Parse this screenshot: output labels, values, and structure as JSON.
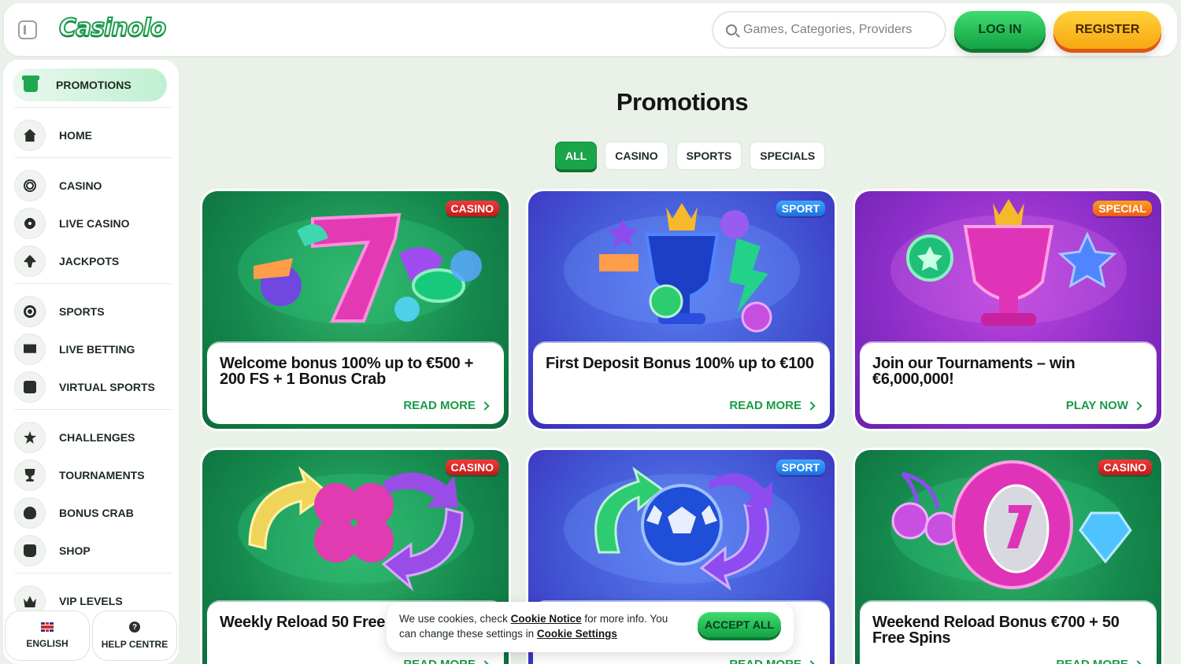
{
  "header": {
    "logo_text": "Casinolo",
    "search_placeholder": "Games, Categories, Providers",
    "login_label": "LOG IN",
    "register_label": "REGISTER"
  },
  "sidebar": {
    "promotions_label": "PROMOTIONS",
    "items": [
      {
        "label": "HOME",
        "icon": "home-icon"
      },
      {
        "label": "CASINO",
        "icon": "casino-chip-icon"
      },
      {
        "label": "LIVE CASINO",
        "icon": "live-casino-icon"
      },
      {
        "label": "JACKPOTS",
        "icon": "club-icon"
      },
      {
        "label": "SPORTS",
        "icon": "soccer-ball-icon"
      },
      {
        "label": "LIVE BETTING",
        "icon": "live-tv-icon"
      },
      {
        "label": "VIRTUAL SPORTS",
        "icon": "virtual-sports-icon"
      },
      {
        "label": "CHALLENGES",
        "icon": "star-icon"
      },
      {
        "label": "TOURNAMENTS",
        "icon": "trophy-icon"
      },
      {
        "label": "BONUS CRAB",
        "icon": "crab-icon"
      },
      {
        "label": "SHOP",
        "icon": "shopping-bag-icon"
      },
      {
        "label": "VIP LEVELS",
        "icon": "crown-icon"
      }
    ],
    "footer": {
      "language_label": "ENGLISH",
      "help_label": "HELP CENTRE"
    }
  },
  "main": {
    "title": "Promotions",
    "filters": [
      "ALL",
      "CASINO",
      "SPORTS",
      "SPECIALS"
    ],
    "active_filter": "ALL",
    "cards": [
      {
        "badge": "CASINO",
        "title": "Welcome bonus 100% up to €500 + 200 FS + 1 Bonus Crab",
        "link": "READ MORE"
      },
      {
        "badge": "SPORT",
        "title": "First Deposit Bonus 100% up to €100",
        "link": "READ MORE"
      },
      {
        "badge": "SPECIAL",
        "title": "Join our Tournaments – win €6,000,000!",
        "link": "PLAY NOW"
      },
      {
        "badge": "CASINO",
        "title": "Weekly Reload 50 Free",
        "link": "READ MORE"
      },
      {
        "badge": "SPORT",
        "title": "",
        "link": "READ MORE"
      },
      {
        "badge": "CASINO",
        "title": "Weekend Reload Bonus €700 + 50 Free Spins",
        "link": "READ MORE"
      }
    ]
  },
  "cookie": {
    "text_1": "We use cookies, check",
    "notice_link": "Cookie Notice",
    "text_2": "for more info. You can change these settings in",
    "settings_link": "Cookie Settings",
    "accept_label": "ACCEPT ALL"
  }
}
